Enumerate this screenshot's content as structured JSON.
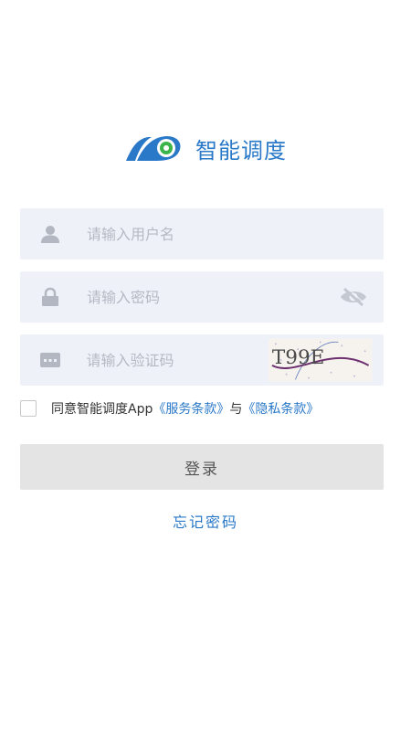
{
  "app": {
    "title": "智能调度",
    "brand_color": "#2a79c8",
    "accent_green": "#3bb54a"
  },
  "form": {
    "username_placeholder": "请输入用户名",
    "password_placeholder": "请输入密码",
    "captcha_placeholder": "请输入验证码",
    "captcha_text": "T99E"
  },
  "agreement": {
    "prefix": "同意智能调度App",
    "service_link": "《服务条款》",
    "connector": "与",
    "privacy_link": "《隐私条款》",
    "checked": false
  },
  "actions": {
    "login_label": "登录",
    "forgot_label": "忘记密码"
  },
  "icons": {
    "username": "user-icon",
    "password": "lock-icon",
    "captcha": "keyboard-icon",
    "toggle": "eye-off-icon"
  }
}
